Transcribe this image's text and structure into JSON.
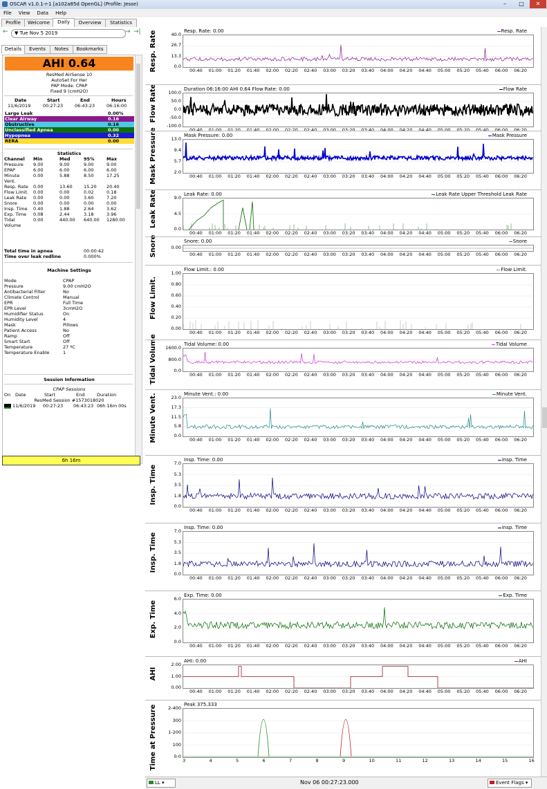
{
  "window": {
    "title": "OSCAR v1.0.1-r-1 [a102a85d OpenGL] (Profile: Jesse)"
  },
  "menu": [
    "File",
    "View",
    "Data",
    "Help"
  ],
  "tabs": [
    "Profile",
    "Welcome",
    "Daily",
    "Overview",
    "Statistics"
  ],
  "date": "Tue Nov 5 2019",
  "subtabs": [
    "Details",
    "Events",
    "Notes",
    "Bookmarks"
  ],
  "ahi": "AHI 0.64",
  "machine": {
    "model": "ResMed AirSense 10",
    "name": "AutoSet For Her",
    "mode": "PAP Mode: CPAP",
    "fixed": "Fixed 9 (cmH2O)"
  },
  "session_headers": [
    "Date",
    "Start",
    "End",
    "Hours"
  ],
  "session_row": [
    "11/6/2019",
    "00:27:23",
    "06:43:23",
    "06:16:00"
  ],
  "events": [
    {
      "name": "Large Leak",
      "value": "0.00%",
      "color": "#ffffff",
      "text": "#000000"
    },
    {
      "name": "Clear Airway",
      "value": "0.16",
      "color": "#8a1a8a",
      "text": "#ffffff"
    },
    {
      "name": "Obstructive",
      "value": "0.16",
      "color": "#4fc7e6",
      "text": "#000000"
    },
    {
      "name": "Unclassified Apnea",
      "value": "0.00",
      "color": "#0d6e0d",
      "text": "#ffffff"
    },
    {
      "name": "Hypopnea",
      "value": "0.32",
      "color": "#1a1ad1",
      "text": "#ffffff"
    },
    {
      "name": "RERA",
      "value": "0.00",
      "color": "#ffdd33",
      "text": "#000000"
    }
  ],
  "stats_title": "Statistics",
  "stats_headers": [
    "Channel",
    "Min",
    "Med",
    "95%",
    "Max"
  ],
  "stats": [
    [
      "Pressure",
      "9.00",
      "9.00",
      "9.00",
      "9.00"
    ],
    [
      "EPAP",
      "6.00",
      "6.00",
      "6.00",
      "6.00"
    ],
    [
      "Minute",
      "0.00",
      "5.88",
      "8.50",
      "17.25"
    ],
    [
      "Vent.",
      "",
      "",
      "",
      ""
    ],
    [
      "Resp. Rate",
      "0.00",
      "13.60",
      "15.20",
      "20.40"
    ],
    [
      "Flow Limit.",
      "0.00",
      "0.00",
      "0.02",
      "0.18"
    ],
    [
      "Leak Rate",
      "0.00",
      "0.00",
      "3.60",
      "7.20"
    ],
    [
      "Snore",
      "0.00",
      "0.00",
      "0.00",
      "0.00"
    ],
    [
      "Insp. Time",
      "0.40",
      "1.88",
      "2.64",
      "3.62"
    ],
    [
      "Exp. Time",
      "0.08",
      "2.44",
      "3.18",
      "3.96"
    ],
    [
      "Tidal",
      "0.00",
      "440.00",
      "640.00",
      "1280.00"
    ],
    [
      "Volume",
      "",
      "",
      "",
      ""
    ]
  ],
  "apnea_time": {
    "label": "Total time in apnea",
    "value": "00:00:42"
  },
  "leak_time": {
    "label": "Time over leak redline",
    "value": "0.000%"
  },
  "settings_title": "Machine Settings",
  "settings": [
    [
      "Mode",
      "CPAP"
    ],
    [
      "Pressure",
      "9.00 cmH2O"
    ],
    [
      "Antibacterial Filter",
      "No"
    ],
    [
      "Climate Control",
      "Manual"
    ],
    [
      "EPR",
      "Full Time"
    ],
    [
      "EPR Level",
      "3cmH2O"
    ],
    [
      "Humidifier Status",
      "On"
    ],
    [
      "Humidity Level",
      "4"
    ],
    [
      "Mask",
      "Pillows"
    ],
    [
      "Patient Access",
      "No"
    ],
    [
      "Ramp",
      "Off"
    ],
    [
      "Smart Start",
      "Off"
    ],
    [
      "Temperature",
      "27 ºC"
    ],
    [
      "Temperature Enable",
      "1"
    ]
  ],
  "session_info_title": "Session Information",
  "cpap_sessions": "CPAP Sessions",
  "session_info_headers": [
    "On",
    "Date",
    "Start",
    "End",
    "Duration"
  ],
  "session_info_name": "ResMed Session #1573018020",
  "session_info_row": [
    "11/6/2019",
    "00:27:23",
    "06:43:23",
    "06h 16m 00s"
  ],
  "duration_bar": "6h 16m",
  "time_ticks": [
    "00:40",
    "01:00",
    "01:20",
    "01:40",
    "02:00",
    "02:20",
    "02:40",
    "03:00",
    "03:20",
    "03:40",
    "04:00",
    "04:20",
    "04:40",
    "05:00",
    "05:20",
    "05:40",
    "06:00",
    "06:20"
  ],
  "graphs": [
    {
      "label": "Resp. Rate",
      "title": "Resp. Rate: 0.00",
      "legend": "Resp. Rate",
      "color": "#8a1a8a",
      "yticks": [
        "40.0",
        "26.7",
        "13.3",
        "0.0"
      ]
    },
    {
      "label": "Flow Rate",
      "title": "Duration 06:16:00 AHI 0.64 Flow Rate: 0.00",
      "legend": "Flow Rate",
      "color": "#000000",
      "yticks": [
        "100.0",
        "50.0",
        "0.0",
        "-50.0",
        "-100.0"
      ]
    },
    {
      "label": "Mask Pressure",
      "title": "Mask Pressure: 0.00",
      "legend": "Mask Pressure",
      "color": "#0000cc",
      "yticks": [
        "13.0",
        "9.4",
        "5.7",
        "2.0"
      ]
    },
    {
      "label": "Leak Rate",
      "title": "Leak Rate: 0.00",
      "legend": "Leak Rate Upper Threshold Leak Rate",
      "color": "#006600",
      "yticks": [
        "9.0",
        "4.5",
        "0.0"
      ]
    },
    {
      "label": "Snore",
      "title": "Snore: 0.00",
      "legend": "Snore",
      "color": "#666666",
      "yticks": [
        "0.00"
      ]
    },
    {
      "label": "Flow Limit.",
      "title": "Flow Limit.: 0.00",
      "legend": "Flow Limit.",
      "color": "#888888",
      "yticks": [
        "1.00",
        "0.80",
        "0.60",
        "0.40",
        "0.20",
        "0.00"
      ]
    },
    {
      "label": "Tidal Volume",
      "title": "Tidal Volume: 0.00",
      "legend": "Tidal Volume",
      "color": "#cc33cc",
      "yticks": [
        "1600.0",
        "800.0",
        "0.0"
      ]
    },
    {
      "label": "Minute Vent.",
      "title": "Minute Vent.: 0.00",
      "legend": "Minute Vent.",
      "color": "#208a8a",
      "yticks": [
        "23.0",
        "17.3",
        "11.5",
        "5.8",
        "0.0"
      ]
    },
    {
      "label": "Insp. Time",
      "title": "Insp. Time: 0.00",
      "legend": "Insp. Time",
      "color": "#000080",
      "yticks": [
        "7.0",
        "5.3",
        "3.5",
        "1.8",
        "0.0"
      ]
    },
    {
      "label": "Insp. Time",
      "title": "Insp. Time: 0.00",
      "legend": "Insp. Time",
      "color": "#000080",
      "yticks": [
        "7.0",
        "5.3",
        "3.5",
        "1.8",
        "0.0"
      ]
    },
    {
      "label": "Exp. Time",
      "title": "Exp. Time: 0.00",
      "legend": "Exp. Time",
      "color": "#006600",
      "yticks": [
        "6.0",
        "4.0",
        "2.0",
        "0.0"
      ]
    },
    {
      "label": "AHI",
      "title": "AHI: 0.00",
      "legend": "AHI",
      "color": "#8a1a1a",
      "yticks": [
        "2.00",
        "1.00",
        "0.00"
      ]
    },
    {
      "label": "Time at Pressure",
      "title": "Peak 375.333",
      "legend": "",
      "color": "#000000",
      "yticks": [
        "2-400",
        "300",
        "1-200",
        "100",
        "0-0"
      ]
    }
  ],
  "pressure_xticks": [
    "3",
    "4",
    "5",
    "6",
    "7",
    "8",
    "9",
    "10",
    "11",
    "12",
    "13",
    "14",
    "15",
    "16"
  ],
  "status": {
    "layout": "LL",
    "time": "Nov 06 00:27:23.000",
    "flags": "Event Flags"
  }
}
